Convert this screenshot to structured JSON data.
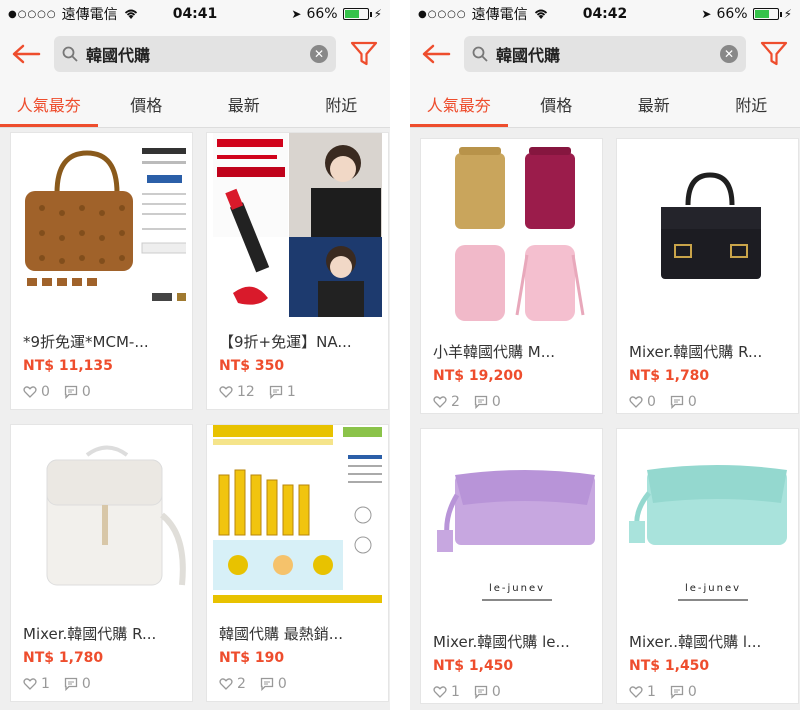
{
  "screens": [
    {
      "status": {
        "carrier": "遠傳電信",
        "time": "04:41",
        "battery": "66%",
        "battery_level": 0.66
      },
      "search": {
        "query": "韓國代購"
      },
      "tabs": [
        "人氣最夯",
        "價格",
        "最新",
        "附近"
      ],
      "active_tab": 0,
      "products": [
        {
          "title": "*9折免運*MCM-...",
          "price": "NT$ 11,135",
          "likes": "0",
          "comments": "0",
          "image": "brown-monogram-handbag"
        },
        {
          "title": "【9折+免運】NA...",
          "price": "NT$ 350",
          "likes": "12",
          "comments": "1",
          "image": "lipstick-ad-collage"
        },
        {
          "title": "Mixer.韓國代購 R...",
          "price": "NT$ 1,780",
          "likes": "1",
          "comments": "0",
          "image": "white-backpack"
        },
        {
          "title": "韓國代購 最熱銷...",
          "price": "NT$ 190",
          "likes": "2",
          "comments": "0",
          "image": "propolis-toothpaste-ad"
        }
      ]
    },
    {
      "status": {
        "carrier": "遠傳電信",
        "time": "04:42",
        "battery": "66%",
        "battery_level": 0.66
      },
      "search": {
        "query": "韓國代購"
      },
      "tabs": [
        "人氣最夯",
        "價格",
        "最新",
        "附近"
      ],
      "active_tab": 0,
      "products": [
        {
          "title": "小羊韓國代購 M...",
          "price": "NT$ 19,200",
          "likes": "2",
          "comments": "0",
          "image": "backpack-four-colors"
        },
        {
          "title": "Mixer.韓國代購 R...",
          "price": "NT$ 1,780",
          "likes": "0",
          "comments": "0",
          "image": "black-handbag"
        },
        {
          "title": "Mixer.韓國代購 le...",
          "price": "NT$ 1,450",
          "likes": "1",
          "comments": "0",
          "image": "lavender-clutch",
          "brand": "le-junev"
        },
        {
          "title": "Mixer..韓國代購 l...",
          "price": "NT$ 1,450",
          "likes": "1",
          "comments": "0",
          "image": "mint-clutch",
          "brand": "le-junev"
        }
      ]
    }
  ],
  "colors": {
    "accent": "#ee4d2d",
    "battery": "#35c24a",
    "muted": "#999999"
  },
  "icons": {
    "back": "arrow-left-icon",
    "search": "search-icon",
    "clear": "clear-icon",
    "filter": "filter-icon",
    "like": "heart-icon",
    "comment": "comment-icon"
  }
}
